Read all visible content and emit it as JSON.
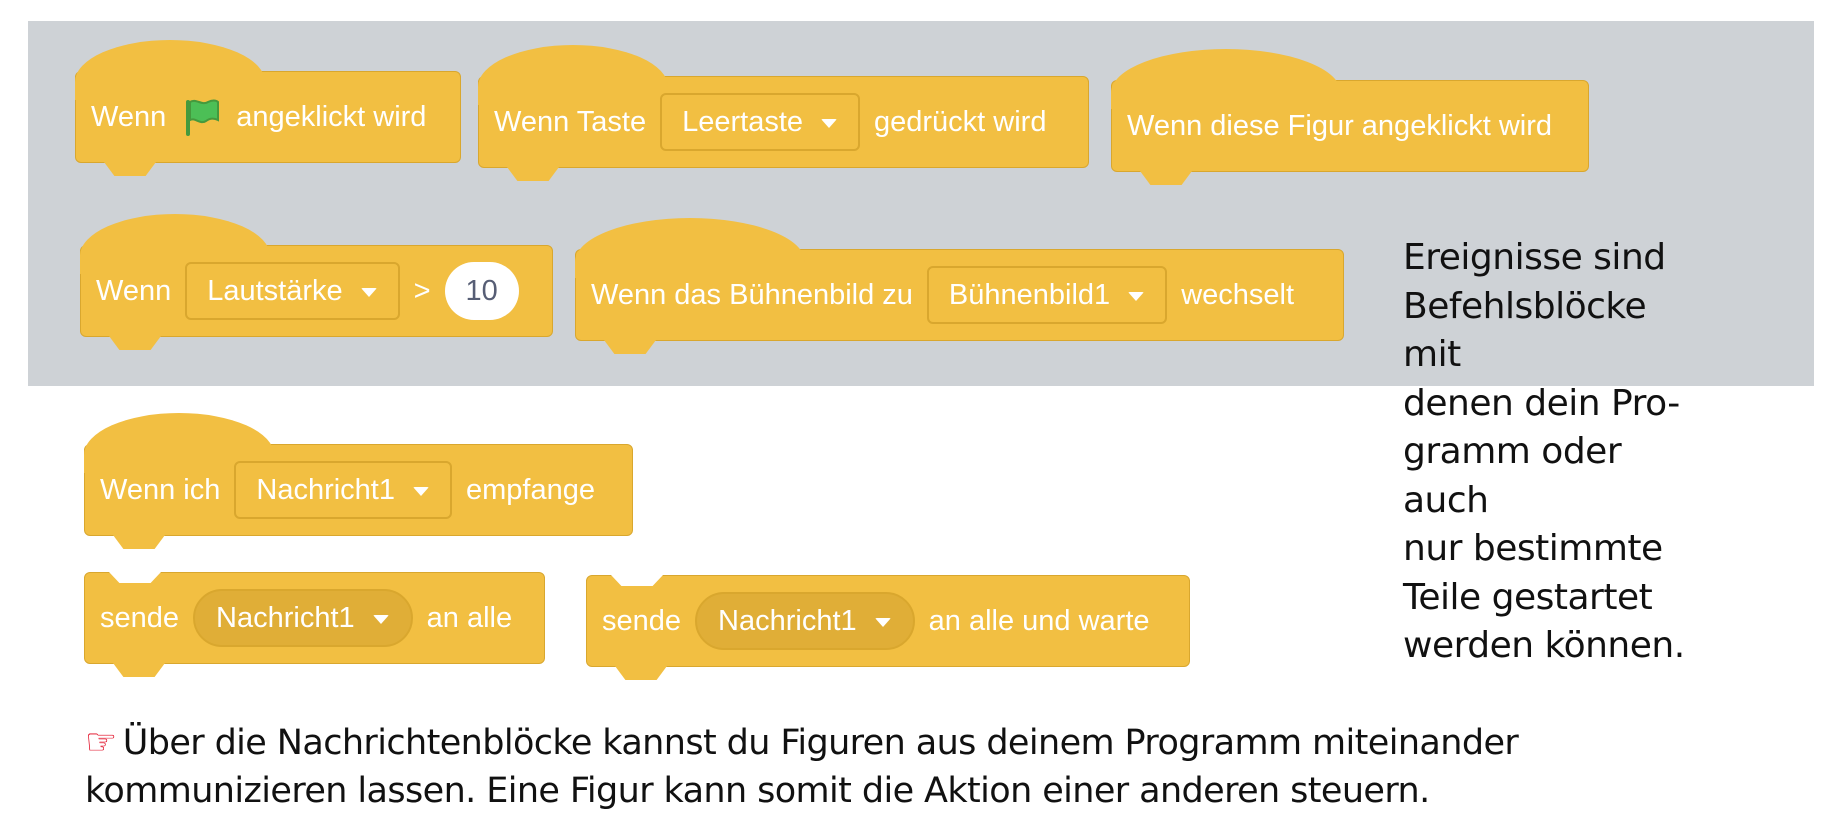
{
  "colors": {
    "band": "#ced2d6",
    "block": "#f2bf42",
    "block_border": "#d9a72e",
    "flag": "#4cbf56",
    "hand": "#e0001a"
  },
  "blocks": {
    "green_flag": {
      "pre": "Wenn",
      "icon": "green-flag-icon",
      "post": "angeklickt wird"
    },
    "key_pressed": {
      "pre": "Wenn Taste",
      "dropdown": "Leertaste",
      "post": "gedrückt wird"
    },
    "sprite_clicked": {
      "text": "Wenn diese Figur angeklickt wird"
    },
    "loudness": {
      "pre": "Wenn",
      "dropdown": "Lautstärke",
      "op": ">",
      "value": "10"
    },
    "backdrop": {
      "pre": "Wenn das Bühnenbild zu",
      "dropdown": "Bühnenbild1",
      "post": "wechselt"
    },
    "receive": {
      "pre": "Wenn ich",
      "dropdown": "Nachricht1",
      "post": "empfange"
    },
    "broadcast": {
      "pre": "sende",
      "dropdown": "Nachricht1",
      "post": "an alle"
    },
    "broadcast_wait": {
      "pre": "sende",
      "dropdown": "Nachricht1",
      "post": "an alle und warte"
    }
  },
  "side_text": [
    "Ereignisse sind",
    "Befehlsblöcke mit",
    "denen dein Pro-",
    "gramm oder auch",
    "nur bestimmte",
    "Teile gestartet",
    "werden können."
  ],
  "tip": {
    "icon": "pointing-hand-icon",
    "line1": "Über die Nachrichtenblöcke kannst du Figuren aus deinem Programm miteinander",
    "line2": "kommunizieren lassen. Eine Figur kann somit die Aktion einer anderen steuern."
  }
}
